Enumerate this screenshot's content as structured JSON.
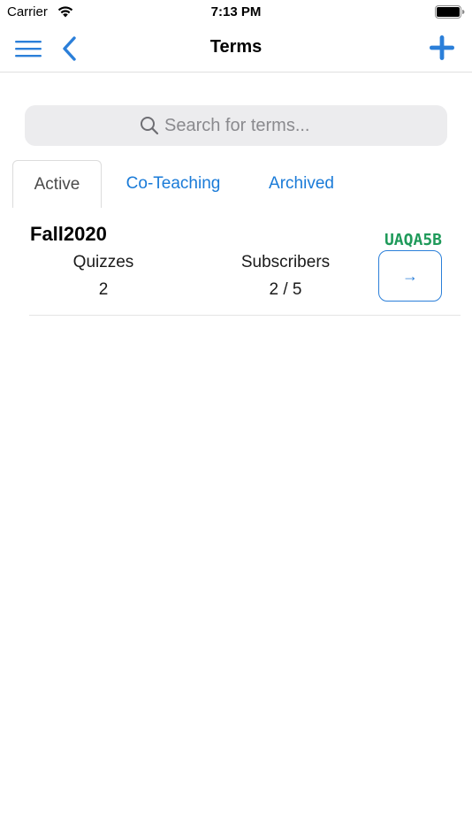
{
  "status_bar": {
    "carrier": "Carrier",
    "time": "7:13 PM"
  },
  "nav": {
    "title": "Terms"
  },
  "search": {
    "placeholder": "Search for terms..."
  },
  "tabs": [
    {
      "label": "Active",
      "selected": true
    },
    {
      "label": "Co-Teaching",
      "selected": false
    },
    {
      "label": "Archived",
      "selected": false
    }
  ],
  "terms": [
    {
      "name": "Fall2020",
      "code": "UAQA5B",
      "quizzes_label": "Quizzes",
      "quizzes_value": "2",
      "subscribers_label": "Subscribers",
      "subscribers_value": "2 / 5",
      "action_icon": "→"
    }
  ],
  "colors": {
    "accent": "#2b7fd9",
    "code_green": "#1f9a5a",
    "tab_blue": "#1a7bd8"
  }
}
